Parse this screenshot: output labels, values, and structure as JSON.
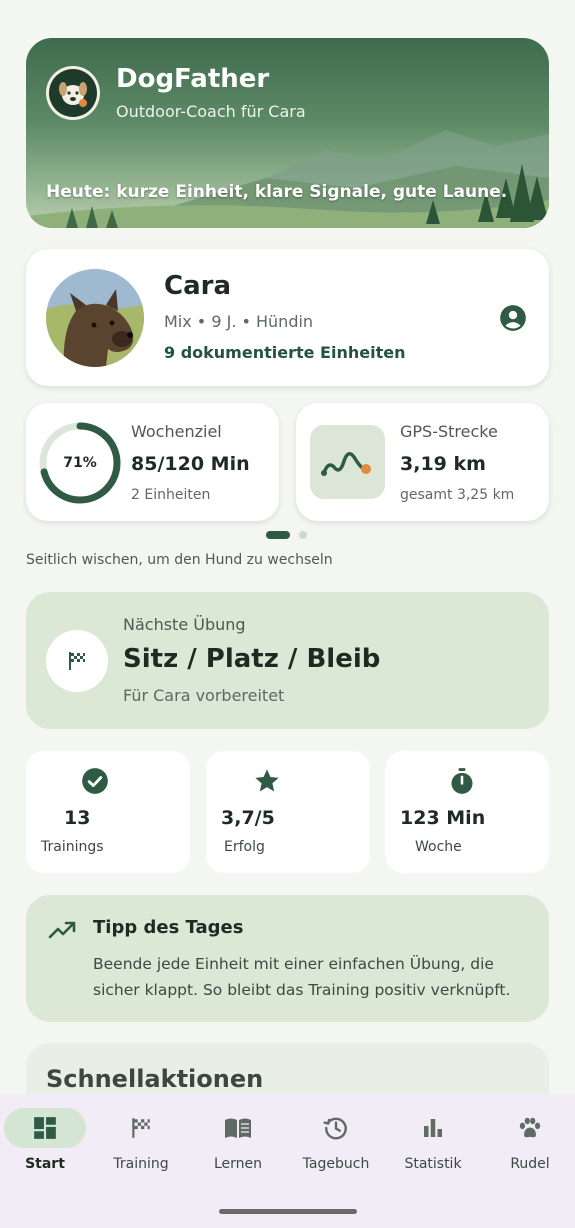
{
  "hero": {
    "app_title": "DogFather",
    "subtitle": "Outdoor-Coach für Cara",
    "motto": "Heute: kurze Einheit, klare Signale, gute Laune."
  },
  "dog": {
    "name": "Cara",
    "meta": "Mix • 9 J. • Hündin",
    "units": "9 dokumentierte Einheiten",
    "profile_icon": "account-circle-icon"
  },
  "weekly_goal": {
    "percent_label": "71%",
    "progress": 0.71,
    "label": "Wochenziel",
    "value": "85/120 Min",
    "sub": "2 Einheiten"
  },
  "gps": {
    "label": "GPS-Strecke",
    "value": "3,19 km",
    "sub": "gesamt 3,25 km",
    "icon": "route-icon"
  },
  "pager": {
    "hint": "Seitlich wischen, um den Hund zu wechseln",
    "pages": 2,
    "active": 0
  },
  "next_exercise": {
    "label": "Nächste Übung",
    "title": "Sitz / Platz / Bleib",
    "sub": "Für Cara vorbereitet",
    "icon": "checkered-flag-icon"
  },
  "stats": [
    {
      "icon": "check-circle-icon",
      "value": "13",
      "label": "Trainings"
    },
    {
      "icon": "star-icon",
      "value": "3,7/5",
      "label": "Erfolg"
    },
    {
      "icon": "timer-icon",
      "value": "123 Min",
      "label": "Woche"
    }
  ],
  "tip": {
    "icon": "trending-up-icon",
    "title": "Tipp des Tages",
    "text": "Beende jede Einheit mit einer einfachen Übung, die sicher klappt. So bleibt das Training positiv verknüpft."
  },
  "quick_actions": {
    "title": "Schnellaktionen"
  },
  "nav": [
    {
      "label": "Start",
      "icon": "dashboard-icon",
      "active": true
    },
    {
      "label": "Training",
      "icon": "flag-icon",
      "active": false
    },
    {
      "label": "Lernen",
      "icon": "book-icon",
      "active": false
    },
    {
      "label": "Tagebuch",
      "icon": "history-icon",
      "active": false
    },
    {
      "label": "Statistik",
      "icon": "bar-chart-icon",
      "active": false
    },
    {
      "label": "Rudel",
      "icon": "paw-icon",
      "active": false
    }
  ],
  "colors": {
    "primary": "#2f5a43",
    "accent": "#e08a3c",
    "tint": "#dbe8d6",
    "nav_bg": "#f1ecf5"
  }
}
